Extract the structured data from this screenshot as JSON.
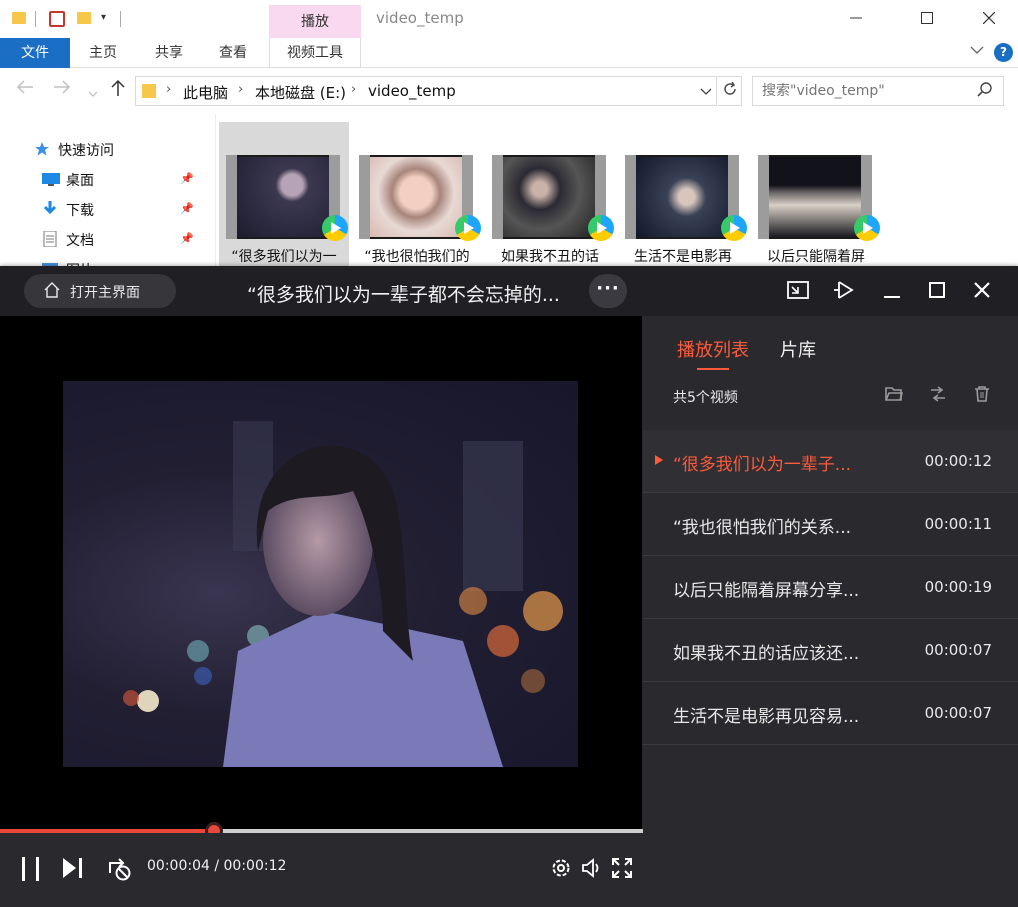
{
  "explorer": {
    "window_title": "video_temp",
    "context_tab": "播放",
    "ribbon_tabs": [
      "文件",
      "主页",
      "共享",
      "查看",
      "视频工具"
    ],
    "address": {
      "crumbs": [
        "此电脑",
        "本地磁盘 (E:)",
        "video_temp"
      ]
    },
    "search": {
      "placeholder": "搜索\"video_temp\""
    },
    "nav": [
      {
        "label": "快速访问",
        "icon": "star-icon"
      },
      {
        "label": "桌面",
        "icon": "desktop-icon",
        "pinned": true
      },
      {
        "label": "下载",
        "icon": "download-icon",
        "pinned": true
      },
      {
        "label": "文档",
        "icon": "document-icon",
        "pinned": true
      },
      {
        "label": "图片",
        "icon": "pictures-icon"
      }
    ],
    "files": [
      {
        "name": "“很多我们以为一",
        "selected": true
      },
      {
        "name": "“我也很怕我们的"
      },
      {
        "name": "如果我不丑的话"
      },
      {
        "name": "生活不是电影再"
      },
      {
        "name": "以后只能隔着屏"
      }
    ]
  },
  "player": {
    "home_label": "打开主界面",
    "title": "“很多我们以为一辈子都不会忘掉的...",
    "more_label": "···",
    "current_time": "00:00:04",
    "total_time": "00:00:12",
    "progress_fraction": 0.333,
    "sidebar": {
      "tabs": [
        "播放列表",
        "片库"
      ],
      "count": "共5个视频",
      "items": [
        {
          "name": "“很多我们以为一辈子...",
          "duration": "00:00:12",
          "active": true
        },
        {
          "name": "“我也很怕我们的关系...",
          "duration": "00:00:11"
        },
        {
          "name": "以后只能隔着屏幕分享...",
          "duration": "00:00:19"
        },
        {
          "name": "如果我不丑的话应该还...",
          "duration": "00:00:07"
        },
        {
          "name": "生活不是电影再见容易...",
          "duration": "00:00:07"
        }
      ]
    },
    "colors": {
      "accent": "#ff5a3c",
      "progress": "#e8473b"
    }
  }
}
